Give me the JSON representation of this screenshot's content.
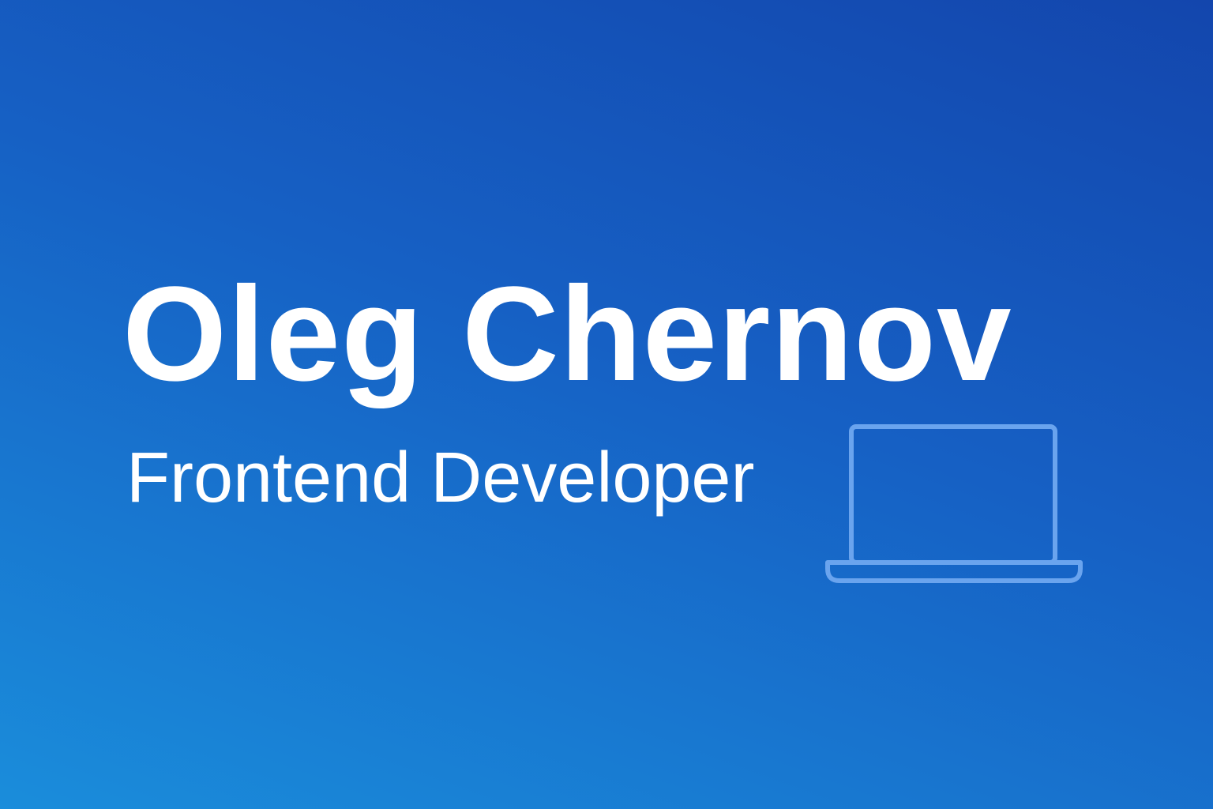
{
  "profile": {
    "name": "Oleg Chernov",
    "role": "Frontend Developer"
  },
  "decoration": {
    "icon": "laptop-icon",
    "icon_color": "#6aa4ee"
  },
  "colors": {
    "gradient_top_right": "#1346ad",
    "gradient_bottom_left": "#1a8ddb",
    "text": "#ffffff"
  }
}
